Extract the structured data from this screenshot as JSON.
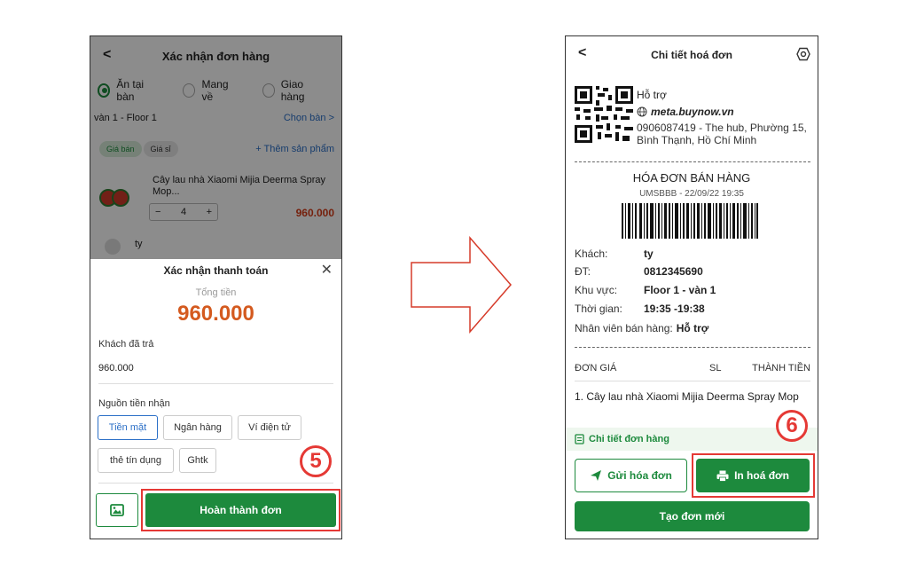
{
  "left": {
    "header_title": "Xác nhận đơn hàng",
    "back_glyph": "<",
    "order_types": [
      "Ăn tại bàn",
      "Mang về",
      "Giao hàng"
    ],
    "table": "vàn 1 - Floor 1",
    "choose_table": "Chọn bàn  >",
    "price_tabs": [
      "Giá bán",
      "Giá sỉ"
    ],
    "add_product": "+  Thêm sản phẩm",
    "product": {
      "name": "Cây lau nhà Xiaomi Mijia Deerma Spray Mop...",
      "qty": "4",
      "price": "960.000"
    },
    "product2_name": "ty",
    "sheet": {
      "title": "Xác nhận thanh toán",
      "close_glyph": "✕",
      "total_label": "Tổng tiền",
      "total_value": "960.000",
      "paid_label": "Khách đã trả",
      "paid_value": "960.000",
      "source_label": "Nguồn tiền nhận",
      "sources": [
        "Tiền mặt",
        "Ngân hàng",
        "Ví điện tử",
        "thẻ tín dụng",
        "Ghtk"
      ],
      "complete_button": "Hoàn thành đơn"
    },
    "step": "5"
  },
  "right": {
    "header_title": "Chi tiết hoá đơn",
    "back_glyph": "<",
    "support_title": "Hỗ trợ",
    "website": "meta.buynow.vn",
    "address": "0906087419 - The hub, Phường 15, Bình Thạnh, Hồ Chí Minh",
    "invoice_title": "HÓA ĐƠN BÁN HÀNG",
    "invoice_code": "UMSBBB - 22/09/22 19:35",
    "customer_label": "Khách:",
    "customer": "ty",
    "phone_label": "ĐT:",
    "phone": "0812345690",
    "area_label": "Khu vực:",
    "area": "Floor 1 - vàn 1",
    "time_label": "Thời gian:",
    "time": "19:35 -19:38",
    "staff_label": "Nhân viên bán hàng:",
    "staff": "Hỗ trợ",
    "col_price": "ĐƠN GIÁ",
    "col_qty": "SL",
    "col_total": "THÀNH TIỀN",
    "item": "1. Cây lau nhà Xiaomi Mijia Deerma Spray Mop",
    "detail_link": "Chi tiết đơn hàng",
    "send_button": "Gửi hóa đơn",
    "print_button": "In hoá đơn",
    "new_button": "Tạo đơn mới"
  },
  "step2": "6",
  "colors": {
    "green": "#1d8a3d",
    "red": "#e53935",
    "orange": "#d45a1f",
    "blue": "#2b6fc7"
  }
}
